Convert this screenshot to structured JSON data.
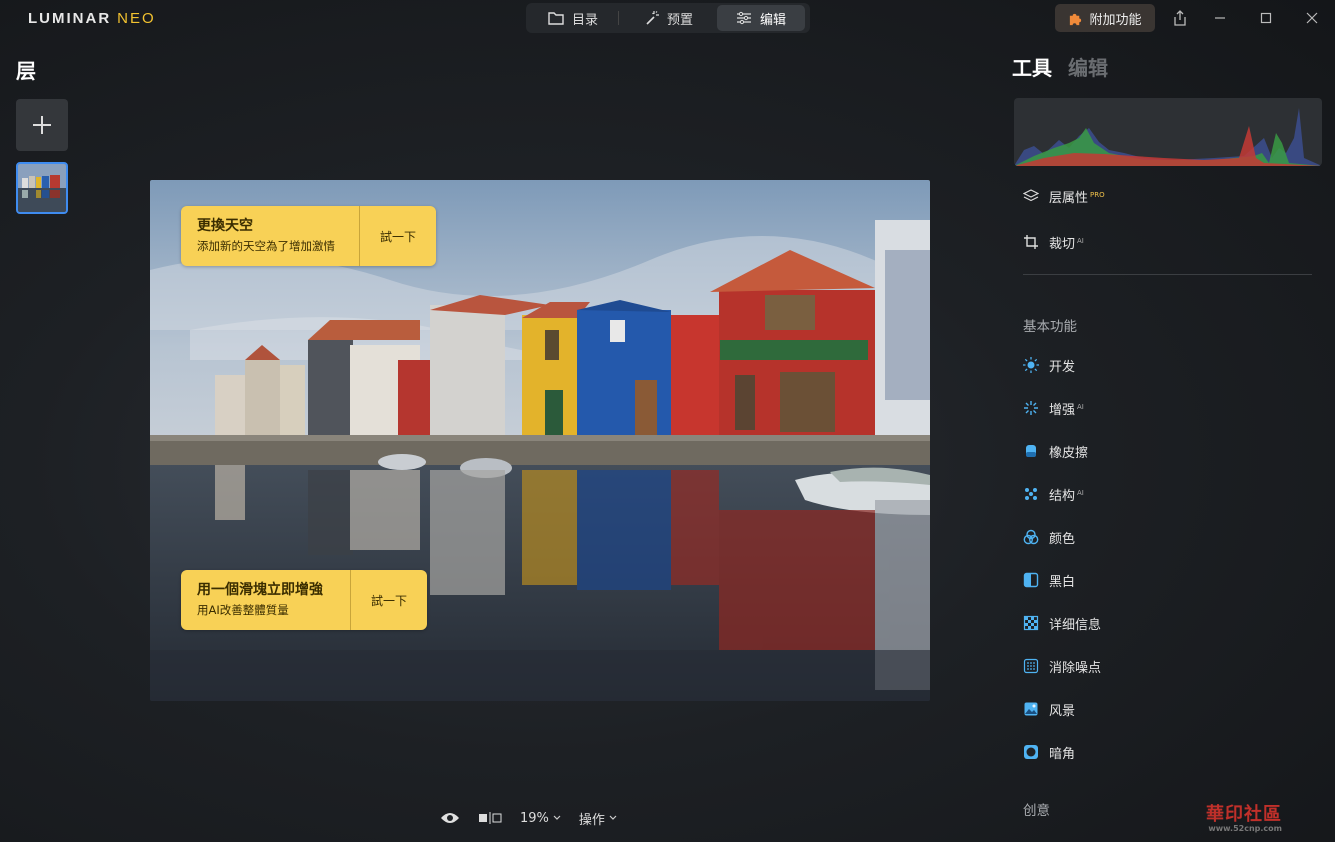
{
  "app": {
    "logo_main": "LUMINAR",
    "logo_neo": "NEO"
  },
  "modes": [
    {
      "label": "目录",
      "icon": "folder-icon"
    },
    {
      "label": "预置",
      "icon": "magic-wand-icon"
    },
    {
      "label": "编辑",
      "icon": "sliders-icon"
    }
  ],
  "addon": {
    "label": "附加功能",
    "icon": "puzzle-icon"
  },
  "layers": {
    "title": "层"
  },
  "canvas": {
    "card1": {
      "title": "更換天空",
      "subtitle": "添加新的天空為了增加激情",
      "cta": "試一下"
    },
    "card2": {
      "title": "用一個滑塊立即增強",
      "subtitle": "用AI改善整體質量",
      "cta": "試一下"
    }
  },
  "bottombar": {
    "zoom": "19%",
    "actions": "操作"
  },
  "rightpanel": {
    "tab_tools": "工具",
    "tab_edits": "编辑",
    "layer_props": {
      "label": "层属性",
      "badge": "PRO"
    },
    "crop": {
      "label": "裁切",
      "badge": "AI"
    },
    "section_basic": "基本功能",
    "tools": [
      {
        "label": "开发",
        "badge": "",
        "icon": "sun-icon"
      },
      {
        "label": "增强",
        "badge": "AI",
        "icon": "sparkle-icon"
      },
      {
        "label": "橡皮擦",
        "badge": "",
        "icon": "eraser-icon"
      },
      {
        "label": "结构",
        "badge": "AI",
        "icon": "dots-icon"
      },
      {
        "label": "颜色",
        "badge": "",
        "icon": "color-circles-icon"
      },
      {
        "label": "黑白",
        "badge": "",
        "icon": "bw-half-icon"
      },
      {
        "label": "详细信息",
        "badge": "",
        "icon": "checker-icon"
      },
      {
        "label": "消除噪点",
        "badge": "",
        "icon": "noise-grid-icon"
      },
      {
        "label": "风景",
        "badge": "",
        "icon": "landscape-icon"
      },
      {
        "label": "暗角",
        "badge": "",
        "icon": "vignette-icon"
      }
    ],
    "section_creative": "创意"
  },
  "watermark": {
    "main": "華印社區",
    "url": "www.52cnp.com"
  },
  "colors": {
    "accent": "#3f8cf0",
    "card": "#f8d156",
    "pro": "#f0c04a"
  }
}
